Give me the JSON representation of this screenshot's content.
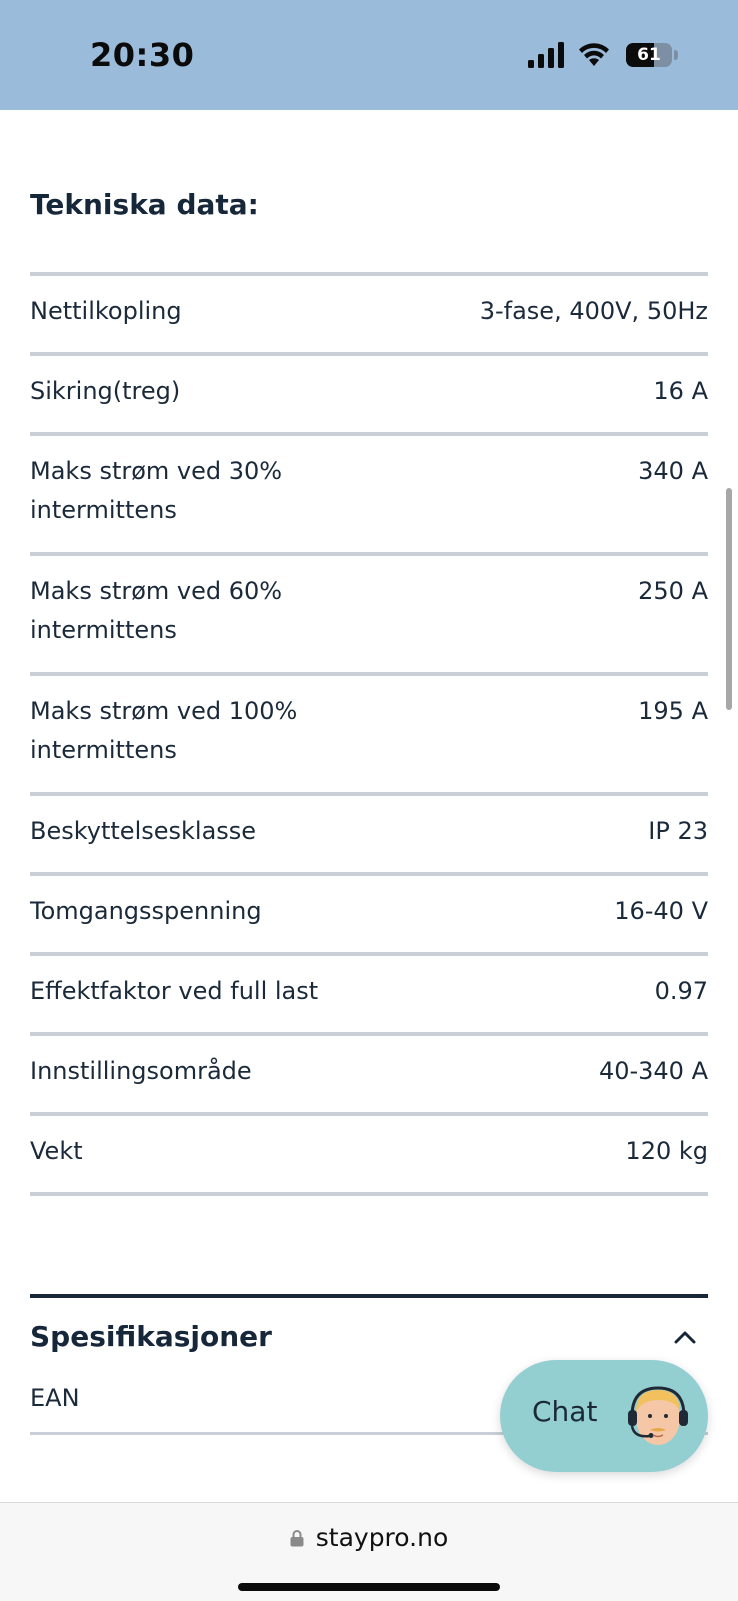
{
  "status_bar": {
    "time": "20:30",
    "battery_percent": "61",
    "battery_level": 0.61,
    "icons": [
      "cellular-signal-icon",
      "wifi-icon",
      "battery-icon"
    ]
  },
  "technical": {
    "title": "Tekniska data:",
    "rows": [
      {
        "label": "Nettilkopling",
        "value": "3-fase, 400V, 50Hz"
      },
      {
        "label": "Sikring(treg)",
        "value": "16 A"
      },
      {
        "label": "Maks strøm ved 30% intermittens",
        "value": "340 A"
      },
      {
        "label": "Maks strøm ved 60% intermittens",
        "value": "250 A"
      },
      {
        "label": "Maks strøm ved 100% intermittens",
        "value": "195 A"
      },
      {
        "label": "Beskyttelsesklasse",
        "value": "IP 23"
      },
      {
        "label": "Tomgangsspenning",
        "value": "16-40 V"
      },
      {
        "label": "Effektfaktor ved full last",
        "value": "0.97"
      },
      {
        "label": "Innstillingsområde",
        "value": "40-340 A"
      },
      {
        "label": "Vekt",
        "value": "120 kg"
      }
    ]
  },
  "specifications": {
    "title": "Spesifikasjoner",
    "toggle_icon": "chevron-up-icon",
    "ean_label": "EAN"
  },
  "chat": {
    "label": "Chat",
    "avatar_icon": "support-agent-icon",
    "color": "#93cfd0"
  },
  "browser": {
    "url": "staypro.no",
    "lock_icon": "lock-icon"
  },
  "colors": {
    "status_bar_bg": "#9bbbdb",
    "text": "#17273a",
    "divider": "#c8cfd6"
  }
}
